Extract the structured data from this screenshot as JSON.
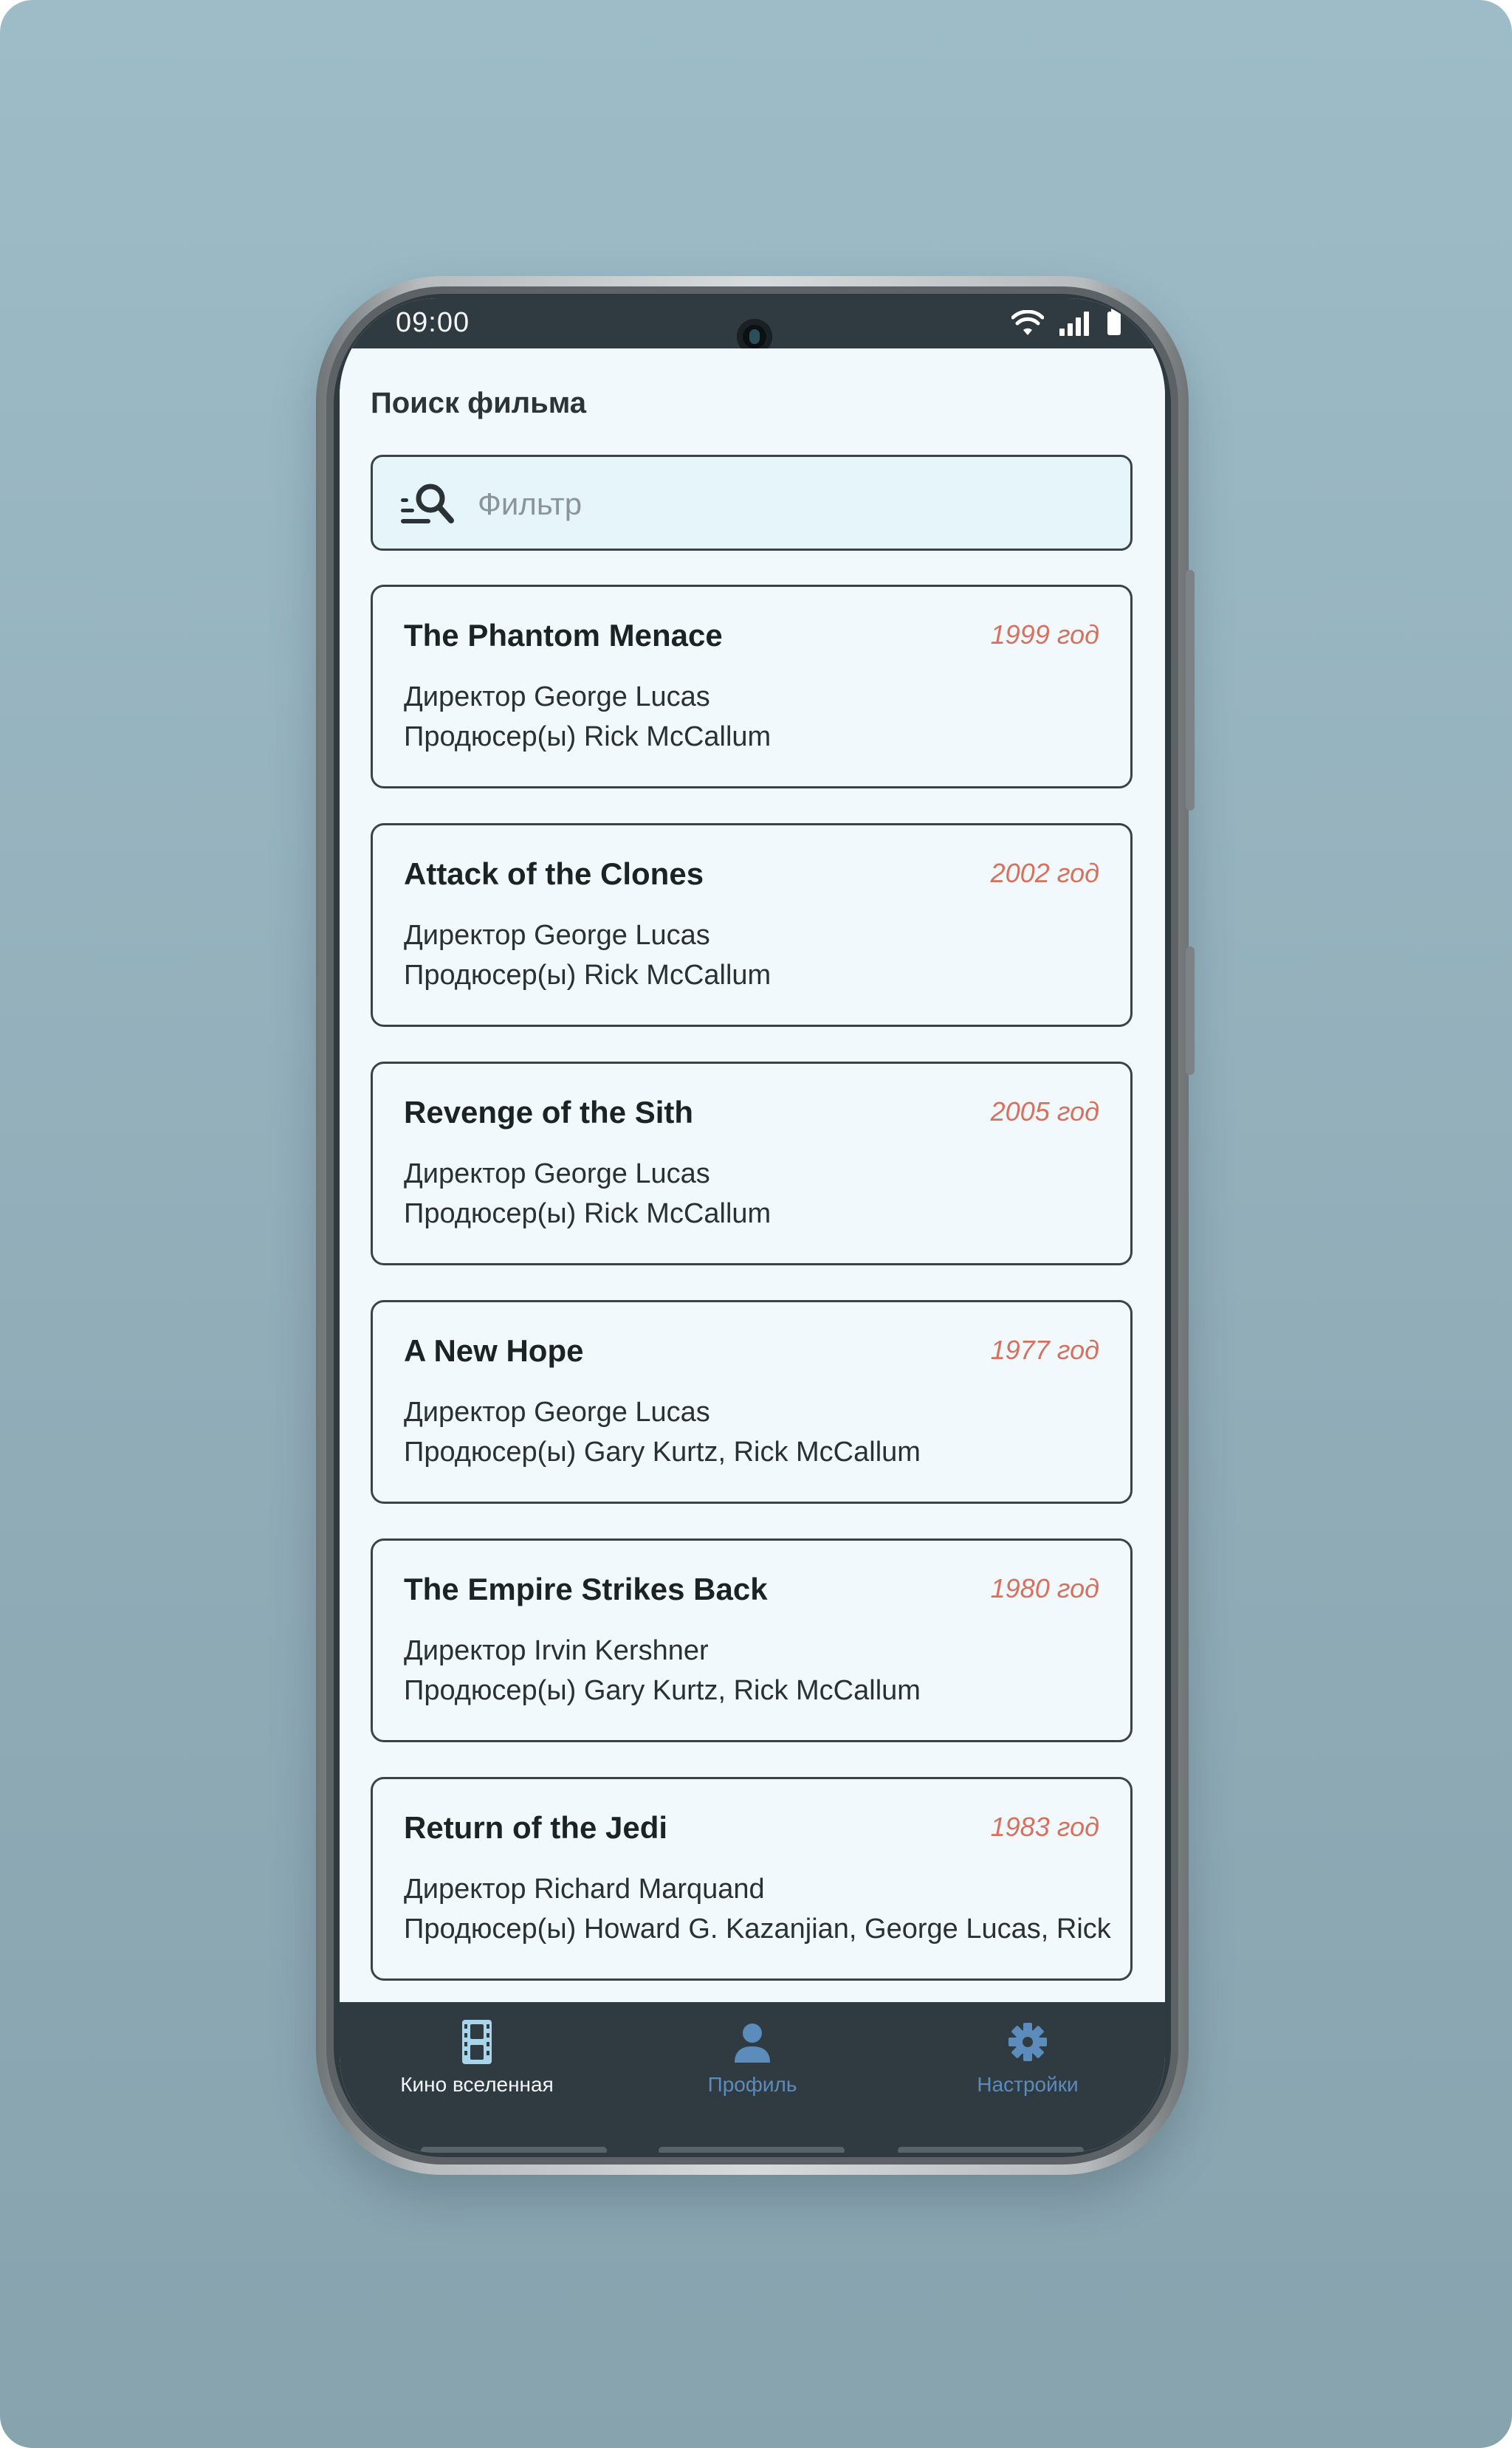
{
  "status_bar": {
    "time": "09:00"
  },
  "page": {
    "title": "Поиск фильма"
  },
  "search": {
    "placeholder": "Фильтр",
    "icon": "search-list-icon"
  },
  "movies": [
    {
      "title": "The Phantom Menace",
      "year": "1999 год",
      "director": "Директор George Lucas",
      "producers": "Продюсер(ы) Rick McCallum"
    },
    {
      "title": "Attack of the Clones",
      "year": "2002 год",
      "director": "Директор George Lucas",
      "producers": "Продюсер(ы) Rick McCallum"
    },
    {
      "title": "Revenge of the Sith",
      "year": "2005 год",
      "director": "Директор George Lucas",
      "producers": "Продюсер(ы) Rick McCallum"
    },
    {
      "title": "A New Hope",
      "year": "1977 год",
      "director": "Директор George Lucas",
      "producers": "Продюсер(ы) Gary Kurtz, Rick McCallum"
    },
    {
      "title": "The Empire Strikes Back",
      "year": "1980 год",
      "director": "Директор Irvin Kershner",
      "producers": "Продюсер(ы) Gary Kurtz, Rick McCallum"
    },
    {
      "title": "Return of the Jedi",
      "year": "1983 год",
      "director": "Директор Richard Marquand",
      "producers": "Продюсер(ы) Howard G. Kazanjian, George Lucas, Rick"
    }
  ],
  "bottom_nav": {
    "items": [
      {
        "label": "Кино вселенная",
        "icon": "film-icon",
        "active": true
      },
      {
        "label": "Профиль",
        "icon": "person-icon",
        "active": false
      },
      {
        "label": "Настройки",
        "icon": "gear-icon",
        "active": false
      }
    ]
  },
  "colors": {
    "background": "#9dbcc8",
    "screen": "#f1f9fc",
    "bars": "#2f3b41",
    "year_accent": "#d8705e",
    "nav_inactive": "#5c8cbc",
    "nav_active_icon": "#a9d5ea"
  }
}
